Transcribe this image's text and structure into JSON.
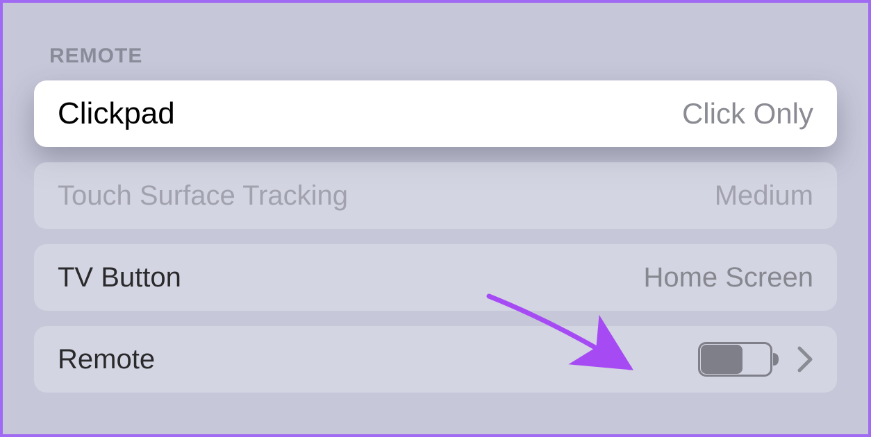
{
  "section_header": "REMOTE",
  "rows": {
    "clickpad": {
      "label": "Clickpad",
      "value": "Click Only"
    },
    "tracking": {
      "label": "Touch Surface Tracking",
      "value": "Medium"
    },
    "tvbutton": {
      "label": "TV Button",
      "value": "Home Screen"
    },
    "remote": {
      "label": "Remote"
    }
  }
}
